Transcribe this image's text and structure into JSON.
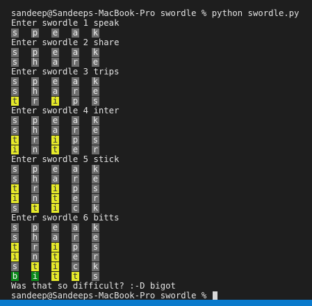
{
  "terminal": {
    "command_line": "sandeep@Sandeeps-MacBook-Pro swordle % python swordle.py",
    "rounds": [
      {
        "prompt": "Enter swordle 1 speak",
        "rows": [
          [
            [
              "s",
              "gray"
            ],
            [
              "p",
              "gray"
            ],
            [
              "e",
              "gray"
            ],
            [
              "a",
              "gray"
            ],
            [
              "k",
              "gray"
            ]
          ]
        ]
      },
      {
        "prompt": "Enter swordle 2 share",
        "rows": [
          [
            [
              "s",
              "gray"
            ],
            [
              "p",
              "gray"
            ],
            [
              "e",
              "gray"
            ],
            [
              "a",
              "gray"
            ],
            [
              "k",
              "gray"
            ]
          ],
          [
            [
              "s",
              "gray"
            ],
            [
              "h",
              "gray"
            ],
            [
              "a",
              "gray"
            ],
            [
              "r",
              "gray"
            ],
            [
              "e",
              "gray"
            ]
          ]
        ]
      },
      {
        "prompt": "Enter swordle 3 trips",
        "rows": [
          [
            [
              "s",
              "gray"
            ],
            [
              "p",
              "gray"
            ],
            [
              "e",
              "gray"
            ],
            [
              "a",
              "gray"
            ],
            [
              "k",
              "gray"
            ]
          ],
          [
            [
              "s",
              "gray"
            ],
            [
              "h",
              "gray"
            ],
            [
              "a",
              "gray"
            ],
            [
              "r",
              "gray"
            ],
            [
              "e",
              "gray"
            ]
          ],
          [
            [
              "t",
              "yellow"
            ],
            [
              "r",
              "gray"
            ],
            [
              "i",
              "yellow"
            ],
            [
              "p",
              "gray"
            ],
            [
              "s",
              "gray"
            ]
          ]
        ]
      },
      {
        "prompt": "Enter swordle 4 inter",
        "rows": [
          [
            [
              "s",
              "gray"
            ],
            [
              "p",
              "gray"
            ],
            [
              "e",
              "gray"
            ],
            [
              "a",
              "gray"
            ],
            [
              "k",
              "gray"
            ]
          ],
          [
            [
              "s",
              "gray"
            ],
            [
              "h",
              "gray"
            ],
            [
              "a",
              "gray"
            ],
            [
              "r",
              "gray"
            ],
            [
              "e",
              "gray"
            ]
          ],
          [
            [
              "t",
              "yellow"
            ],
            [
              "r",
              "gray"
            ],
            [
              "i",
              "yellow"
            ],
            [
              "p",
              "gray"
            ],
            [
              "s",
              "gray"
            ]
          ],
          [
            [
              "i",
              "yellow"
            ],
            [
              "n",
              "gray"
            ],
            [
              "t",
              "yellow"
            ],
            [
              "e",
              "gray"
            ],
            [
              "r",
              "gray"
            ]
          ]
        ]
      },
      {
        "prompt": "Enter swordle 5 stick",
        "rows": [
          [
            [
              "s",
              "gray"
            ],
            [
              "p",
              "gray"
            ],
            [
              "e",
              "gray"
            ],
            [
              "a",
              "gray"
            ],
            [
              "k",
              "gray"
            ]
          ],
          [
            [
              "s",
              "gray"
            ],
            [
              "h",
              "gray"
            ],
            [
              "a",
              "gray"
            ],
            [
              "r",
              "gray"
            ],
            [
              "e",
              "gray"
            ]
          ],
          [
            [
              "t",
              "yellow"
            ],
            [
              "r",
              "gray"
            ],
            [
              "i",
              "yellow"
            ],
            [
              "p",
              "gray"
            ],
            [
              "s",
              "gray"
            ]
          ],
          [
            [
              "i",
              "yellow"
            ],
            [
              "n",
              "gray"
            ],
            [
              "t",
              "yellow"
            ],
            [
              "e",
              "gray"
            ],
            [
              "r",
              "gray"
            ]
          ],
          [
            [
              "s",
              "gray"
            ],
            [
              "t",
              "yellow"
            ],
            [
              "i",
              "yellow"
            ],
            [
              "c",
              "gray"
            ],
            [
              "k",
              "gray"
            ]
          ]
        ]
      },
      {
        "prompt": "Enter swordle 6 bitts",
        "rows": [
          [
            [
              "s",
              "gray"
            ],
            [
              "p",
              "gray"
            ],
            [
              "e",
              "gray"
            ],
            [
              "a",
              "gray"
            ],
            [
              "k",
              "gray"
            ]
          ],
          [
            [
              "s",
              "gray"
            ],
            [
              "h",
              "gray"
            ],
            [
              "a",
              "gray"
            ],
            [
              "r",
              "gray"
            ],
            [
              "e",
              "gray"
            ]
          ],
          [
            [
              "t",
              "yellow"
            ],
            [
              "r",
              "gray"
            ],
            [
              "i",
              "yellow"
            ],
            [
              "p",
              "gray"
            ],
            [
              "s",
              "gray"
            ]
          ],
          [
            [
              "i",
              "yellow"
            ],
            [
              "n",
              "gray"
            ],
            [
              "t",
              "yellow"
            ],
            [
              "e",
              "gray"
            ],
            [
              "r",
              "gray"
            ]
          ],
          [
            [
              "s",
              "gray"
            ],
            [
              "t",
              "yellow"
            ],
            [
              "i",
              "yellow"
            ],
            [
              "c",
              "gray"
            ],
            [
              "k",
              "gray"
            ]
          ],
          [
            [
              "b",
              "green"
            ],
            [
              "i",
              "green"
            ],
            [
              "t",
              "yellow"
            ],
            [
              "t",
              "yellow"
            ],
            [
              "s",
              "gray"
            ]
          ]
        ]
      }
    ],
    "final_message": "Was that so difficult? :-D bigot",
    "prompt_line": "sandeep@Sandeeps-MacBook-Pro swordle % "
  },
  "colors": {
    "background": "#1e1e1e",
    "tile_gray": "#6e6e6e",
    "tile_yellow": "#e6ea2a",
    "tile_green": "#0b8a1a",
    "statusbar": "#0a7acc"
  }
}
